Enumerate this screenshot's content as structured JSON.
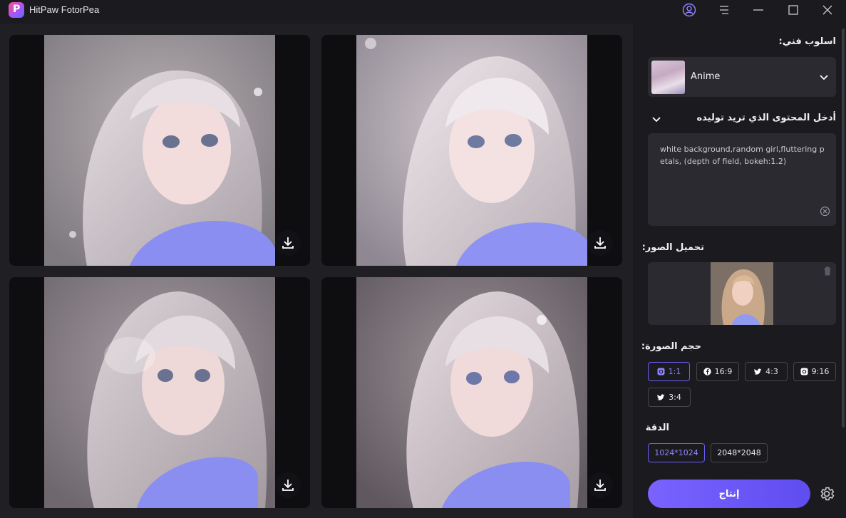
{
  "app": {
    "title": "HitPaw FotorPea",
    "logo_letter": "P"
  },
  "panel": {
    "style_label": "اسلوب فني:",
    "style_value": "Anime",
    "prompt_label": "أدخل المحتوى الذي تريد توليده",
    "prompt_text": "white background,random girl,fluttering petals, (depth of field, bokeh:1.2)",
    "upload_label": "تحميل الصور:",
    "size_label": "حجم الصورة:",
    "sizes": [
      {
        "label": "1:1",
        "icon": "instagram-icon",
        "active": true
      },
      {
        "label": "16:9",
        "icon": "facebook-icon",
        "active": false
      },
      {
        "label": "4:3",
        "icon": "twitter-icon",
        "active": false
      },
      {
        "label": "9:16",
        "icon": "instagram-icon",
        "active": false
      },
      {
        "label": "3:4",
        "icon": "twitter-icon",
        "active": false
      }
    ],
    "resolution_label": "الدقة",
    "resolutions": [
      {
        "label": "1024*1024",
        "active": true
      },
      {
        "label": "2048*2048",
        "active": false
      }
    ],
    "generate_label": "إنتاج"
  },
  "colors": {
    "accent": "#6b5cf5",
    "background": "#1b1b1f",
    "card": "#2a2a30"
  }
}
